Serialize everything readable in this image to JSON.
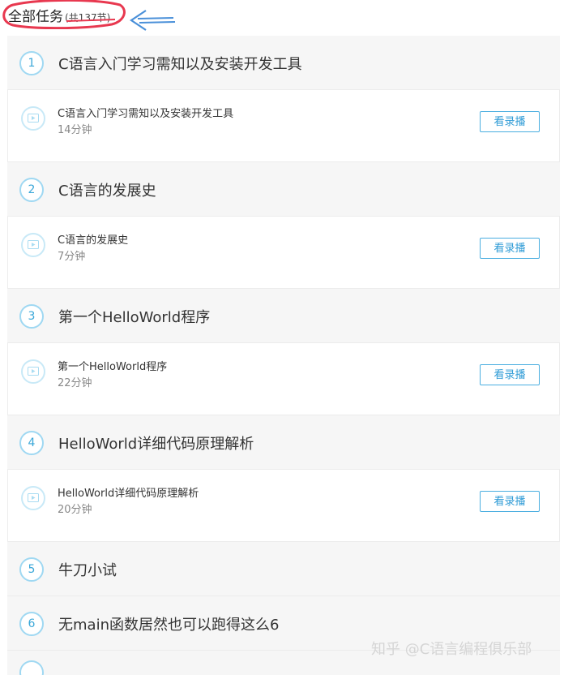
{
  "header": {
    "title": "全部任务",
    "count": "(共137节)"
  },
  "chapters": [
    {
      "num": "1",
      "title": "C语言入门学习需知以及安装开发工具",
      "lesson": {
        "title": "C语言入门学习需知以及安装开发工具",
        "duration": "14分钟",
        "button": "看录播"
      }
    },
    {
      "num": "2",
      "title": "C语言的发展史",
      "lesson": {
        "title": "C语言的发展史",
        "duration": "7分钟",
        "button": "看录播"
      }
    },
    {
      "num": "3",
      "title": "第一个HelloWorld程序",
      "lesson": {
        "title": "第一个HelloWorld程序",
        "duration": "22分钟",
        "button": "看录播"
      }
    },
    {
      "num": "4",
      "title": "HelloWorld详细代码原理解析",
      "lesson": {
        "title": "HelloWorld详细代码原理解析",
        "duration": "20分钟",
        "button": "看录播"
      }
    },
    {
      "num": "5",
      "title": "牛刀小试"
    },
    {
      "num": "6",
      "title": "无main函数居然也可以跑得这么6"
    }
  ],
  "watermark": "知乎 @C语言编程俱乐部",
  "colors": {
    "accent": "#2e9bd6",
    "annotation_red": "#e8384f",
    "annotation_blue": "#4a90d9"
  }
}
